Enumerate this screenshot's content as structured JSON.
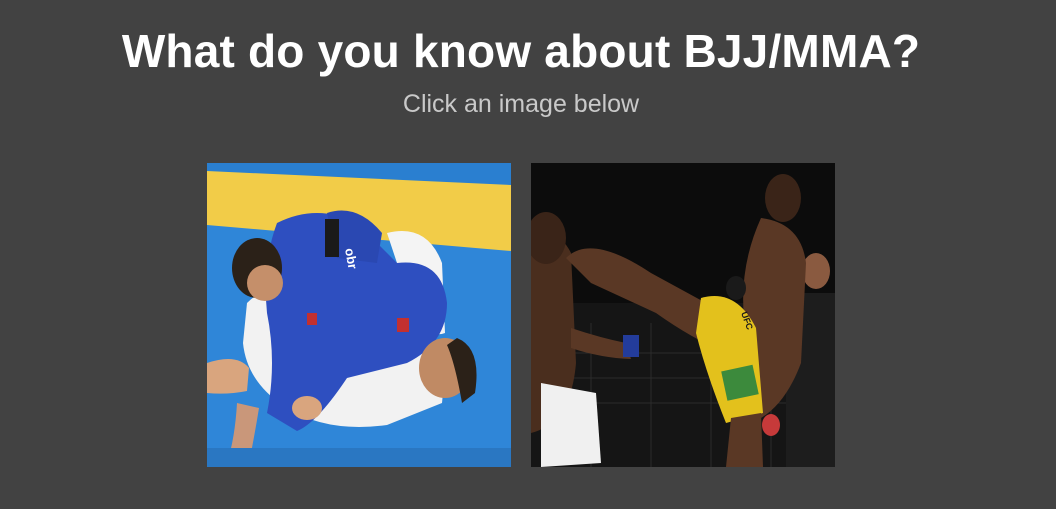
{
  "header": {
    "title": "What do you know about BJJ/MMA?",
    "subtitle": "Click an image below"
  },
  "images": [
    {
      "topic": "BJJ",
      "depicts": "bjj-grappling-photo",
      "jacket_text": "obr",
      "colors": {
        "mat_blue": "#2f86d8",
        "mat_yellow": "#f2cc48",
        "gi_blue": "#2e4fc0",
        "gi_white": "#f2f2f2"
      }
    },
    {
      "topic": "MMA",
      "depicts": "mma-head-kick-photo",
      "shorts_text": "UFC",
      "colors": {
        "background": "#151515",
        "shorts_yellow": "#e3c11c",
        "skin": "#5a3825"
      }
    }
  ],
  "colors": {
    "page_background": "#424242",
    "title": "#ffffff",
    "subtitle": "#c9c9c9"
  }
}
